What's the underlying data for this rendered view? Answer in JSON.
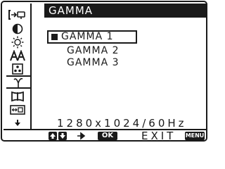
{
  "menu": {
    "title": "GAMMA",
    "options": [
      {
        "label": "GAMMA 1"
      },
      {
        "label": "GAMMA 2"
      },
      {
        "label": "GAMMA 3"
      }
    ],
    "selected_index": 0
  },
  "status": {
    "resolution": "1280x1024/60Hz"
  },
  "footer": {
    "ok_label": "OK",
    "exit_label": "EXIT",
    "menu_label": "MENU"
  },
  "sidebar": {
    "icons": [
      "input-select-icon",
      "contrast-icon",
      "brightness-icon",
      "sharpness-icon",
      "color-icon",
      "gamma-icon",
      "geometry-icon",
      "position-icon",
      "more-icon"
    ],
    "active_index": 5
  }
}
